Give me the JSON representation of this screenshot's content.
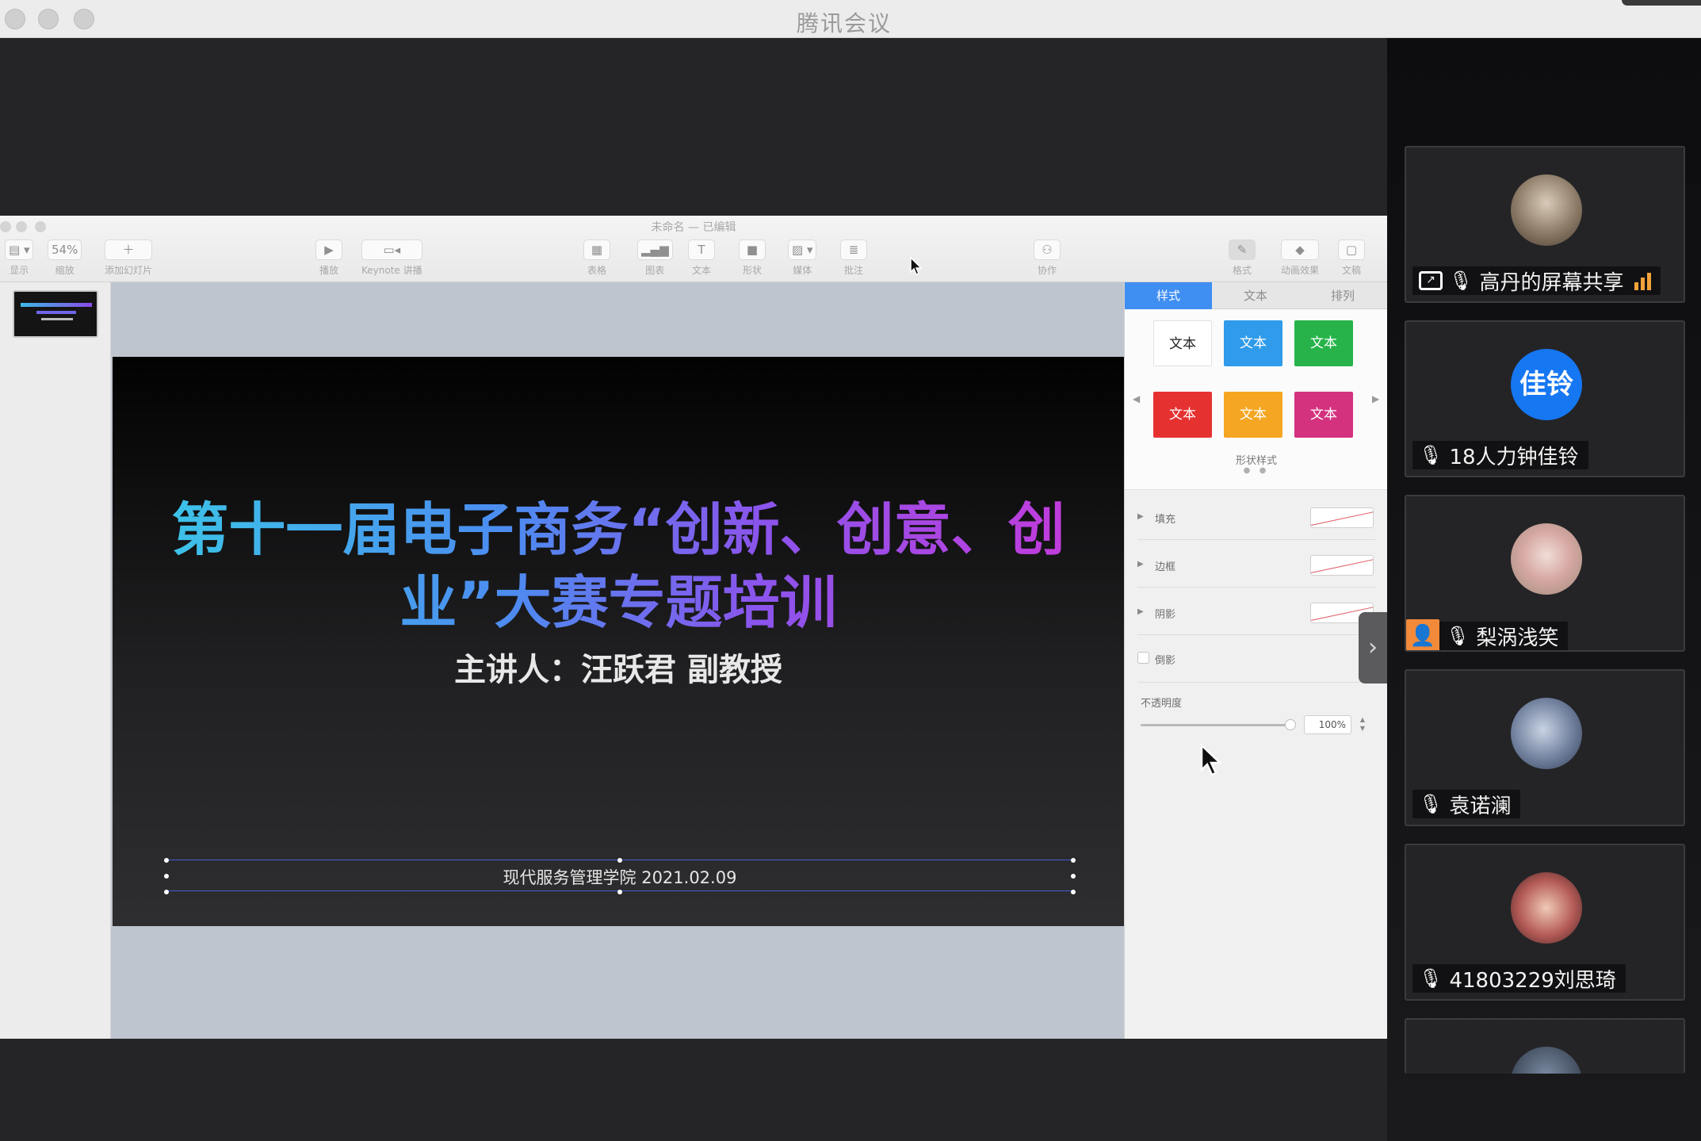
{
  "window": {
    "title": "腾讯会议"
  },
  "keynote": {
    "title": "未命名 — 已编辑",
    "toolbar": {
      "view": "显示",
      "zoom_value": "54%",
      "zoom": "缩放",
      "add_slide": "添加幻灯片",
      "play": "播放",
      "keynote_live": "Keynote 讲播",
      "table": "表格",
      "chart": "图表",
      "text": "文本",
      "shape": "形状",
      "media": "媒体",
      "comment": "批注",
      "collaborate": "协作",
      "format": "格式",
      "animate": "动画效果",
      "document": "文稿"
    },
    "slide": {
      "title": "第十一届电子商务“创新、创意、创业”大赛专题培训",
      "speaker": "主讲人：汪跃君 副教授",
      "footer": "现代服务管理学院 2021.02.09"
    },
    "inspector": {
      "tabs": [
        "样式",
        "文本",
        "排列"
      ],
      "swatch_label": "文本",
      "swatch_colors": [
        "#ffffff",
        "#2f9bea",
        "#27b34a",
        "#e63131",
        "#f5a623",
        "#d4327f"
      ],
      "shape_styles": "形状样式",
      "fill": "填充",
      "border": "边框",
      "shadow": "阴影",
      "reflection": "倒影",
      "opacity_label": "不透明度",
      "opacity_value": "100%"
    }
  },
  "participants": [
    {
      "name": "高丹的屏幕共享",
      "sharing": true
    },
    {
      "name": "18人力钟佳铃",
      "avatar_text": "佳铃"
    },
    {
      "name": "梨涡浅笑"
    },
    {
      "name": "袁诺澜"
    },
    {
      "name": "41803229刘思琦"
    }
  ]
}
